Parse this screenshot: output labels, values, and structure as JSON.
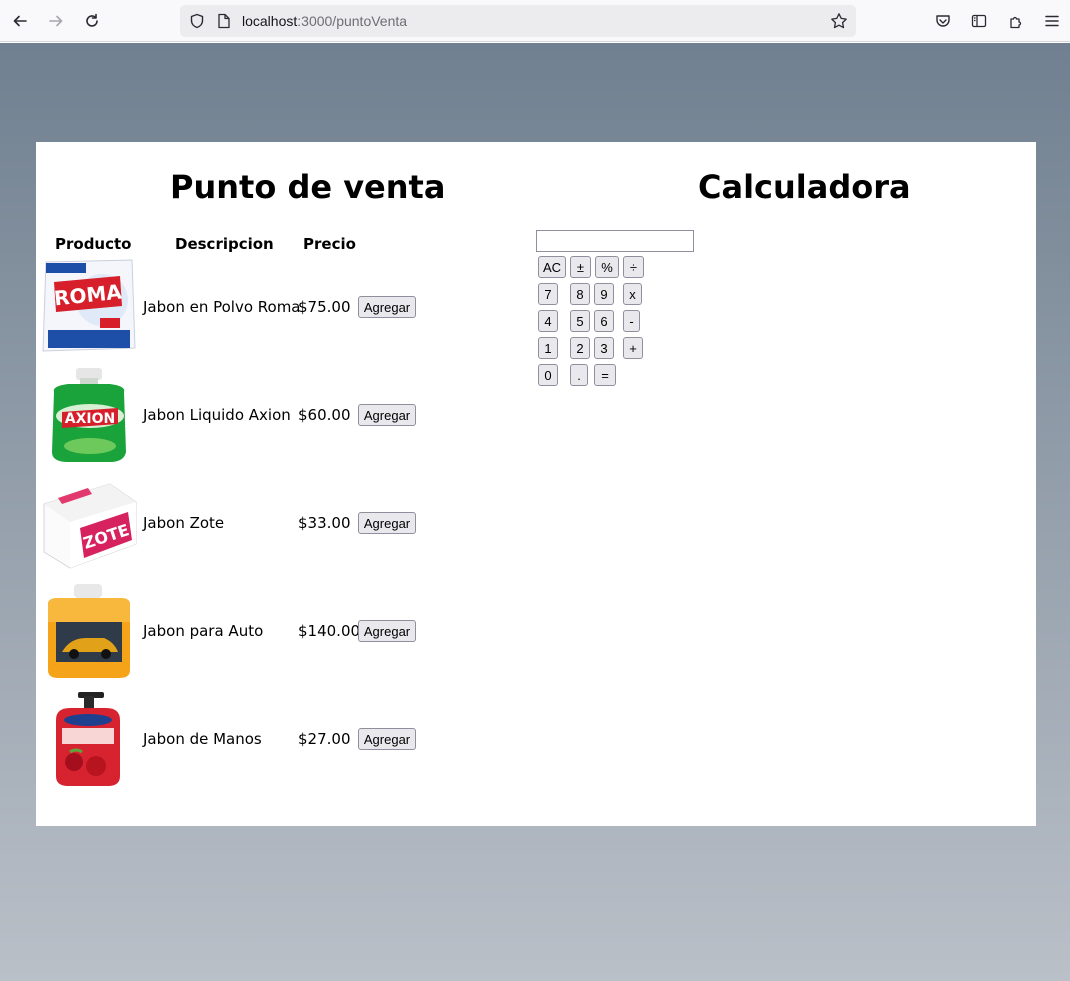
{
  "browser": {
    "url_host": "localhost",
    "url_path": ":3000/puntoVenta"
  },
  "pos": {
    "title": "Punto de venta",
    "headers": {
      "product": "Producto",
      "description": "Descripcion",
      "price": "Precio"
    },
    "products": [
      {
        "description": "Jabon en Polvo Roma",
        "price": "$75.00",
        "button": "Agregar",
        "image_icon": "roma-detergent-bag"
      },
      {
        "description": "Jabon Liquido Axion",
        "price": "$60.00",
        "button": "Agregar",
        "image_icon": "axion-dish-soap-bottle"
      },
      {
        "description": "Jabon Zote",
        "price": "$33.00",
        "button": "Agregar",
        "image_icon": "zote-soap-bar"
      },
      {
        "description": "Jabon para Auto",
        "price": "$140.00",
        "button": "Agregar",
        "image_icon": "car-soap-jug"
      },
      {
        "description": "Jabon de Manos",
        "price": "$27.00",
        "button": "Agregar",
        "image_icon": "hand-soap-pump"
      }
    ]
  },
  "calculator": {
    "title": "Calculadora",
    "display_value": "",
    "keys": {
      "ac": "AC",
      "plusminus": "±",
      "percent": "%",
      "divide": "÷",
      "seven": "7",
      "eight": "8",
      "nine": "9",
      "multiply": "x",
      "four": "4",
      "five": "5",
      "six": "6",
      "minus": "-",
      "one": "1",
      "two": "2",
      "three": "3",
      "plus": "+",
      "zero": "0",
      "dot": ".",
      "equals": "="
    }
  },
  "colors": {
    "background_top": "#708090",
    "background_bottom": "#bac0c8"
  }
}
